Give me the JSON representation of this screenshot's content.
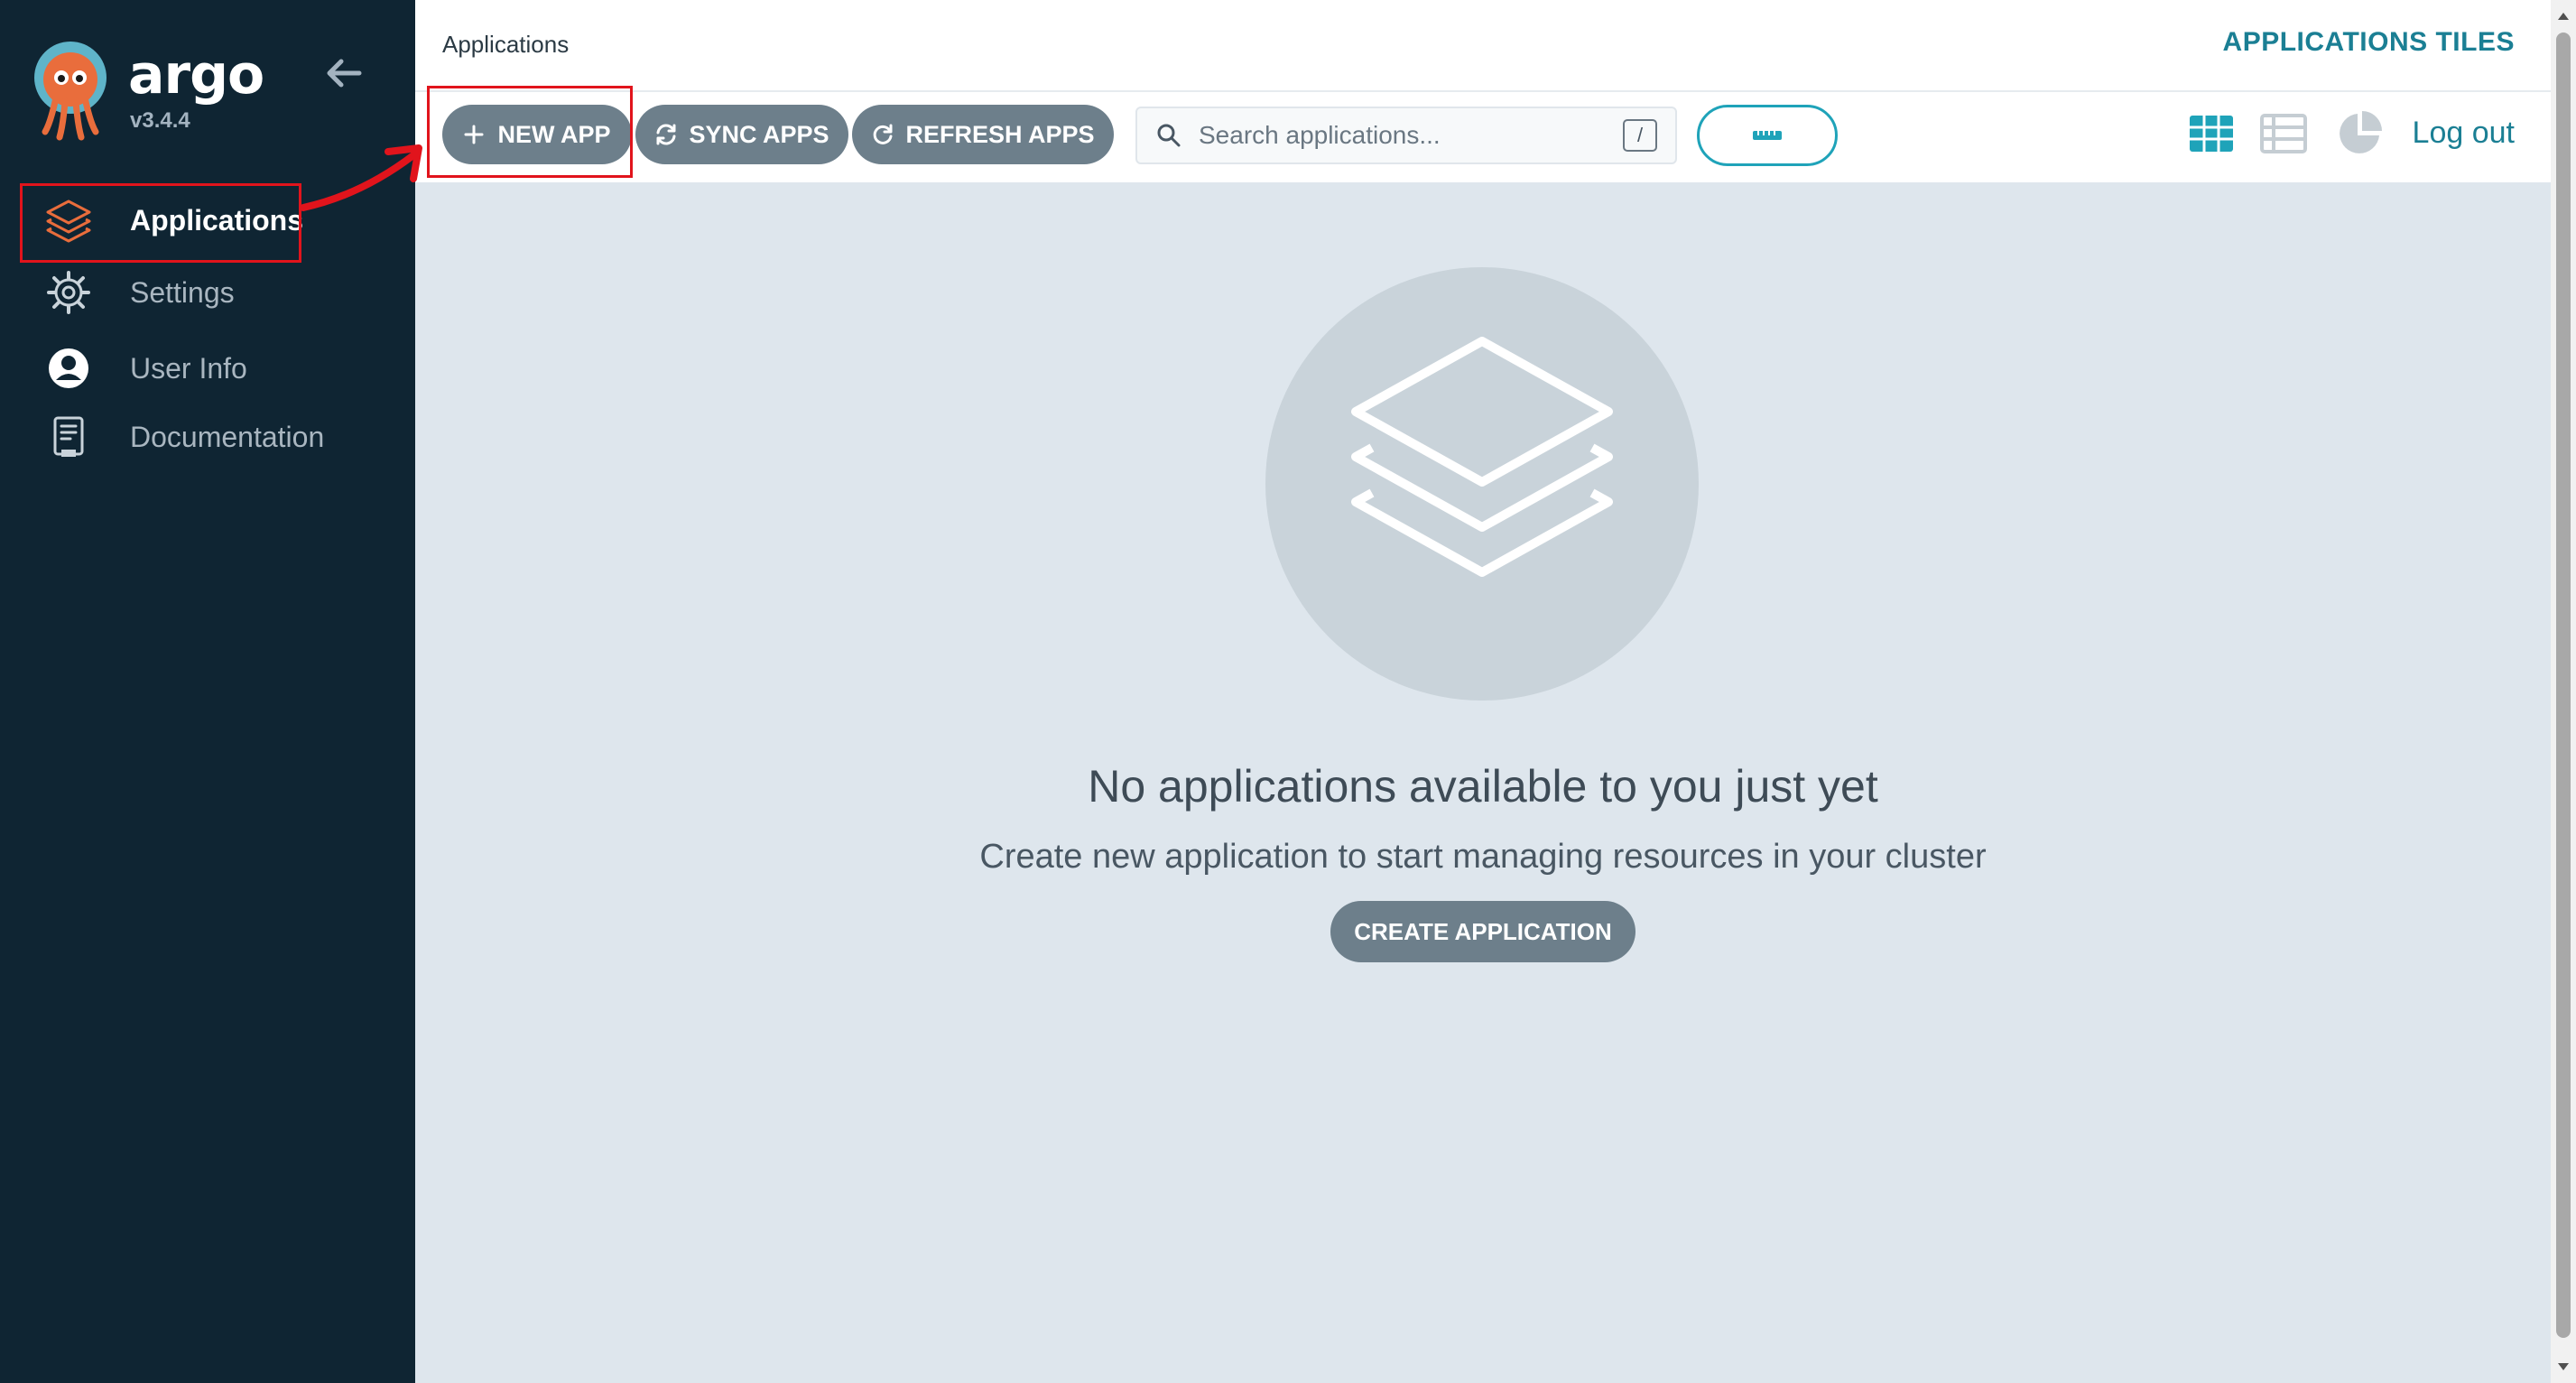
{
  "sidebar": {
    "brand": "argo",
    "version": "v3.4.4",
    "items": [
      {
        "label": "Applications",
        "icon": "layers-icon",
        "active": true
      },
      {
        "label": "Settings",
        "icon": "gear-icon",
        "active": false
      },
      {
        "label": "User Info",
        "icon": "user-icon",
        "active": false
      },
      {
        "label": "Documentation",
        "icon": "document-icon",
        "active": false
      }
    ]
  },
  "header": {
    "breadcrumb": "Applications",
    "view_title": "APPLICATIONS TILES",
    "logout_label": "Log out"
  },
  "toolbar": {
    "new_app_label": "NEW APP",
    "sync_apps_label": "SYNC APPS",
    "refresh_apps_label": "REFRESH APPS",
    "search_placeholder": "Search applications...",
    "search_shortcut": "/"
  },
  "empty_state": {
    "title": "No applications available to you just yet",
    "subtitle": "Create new application to start managing resources in your cluster",
    "create_label": "CREATE APPLICATION"
  },
  "colors": {
    "sidebar_bg": "#0f2533",
    "accent_teal": "#1fa3b9",
    "button_gray": "#6d7f8b",
    "annotation_red": "#e1141c",
    "brand_orange": "#e96d3c"
  }
}
